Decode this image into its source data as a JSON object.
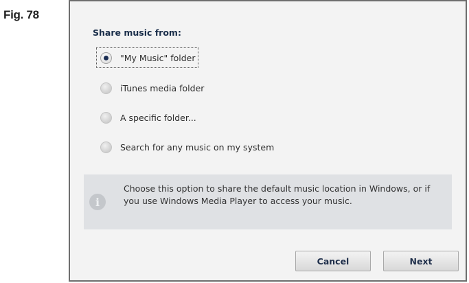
{
  "figure_label": "Fig. 78",
  "dialog": {
    "heading": "Share music from:",
    "options": [
      {
        "label": "\"My Music\" folder",
        "selected": true
      },
      {
        "label": "iTunes media folder",
        "selected": false
      },
      {
        "label": "A specific folder...",
        "selected": false
      },
      {
        "label": "Search for any music on my system",
        "selected": false
      }
    ],
    "info": {
      "icon": "info-icon",
      "text": "Choose this option to share the default music location in Windows, or if you use Windows Media Player to access your music."
    },
    "buttons": {
      "cancel_label": "Cancel",
      "next_label": "Next"
    }
  },
  "colors": {
    "dialog_background": "#f3f3f3",
    "info_background": "#dfe1e4",
    "selected_radio": "#1a2c52"
  }
}
